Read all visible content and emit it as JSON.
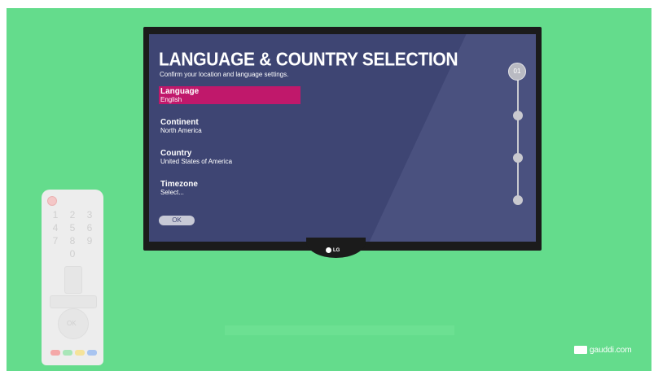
{
  "screen": {
    "title": "LANGUAGE & COUNTRY SELECTION",
    "subtitle": "Confirm your location and language settings.",
    "settings": [
      {
        "label": "Language",
        "value": "English",
        "active": true
      },
      {
        "label": "Continent",
        "value": "North America",
        "active": false
      },
      {
        "label": "Country",
        "value": "United States of America",
        "active": false
      },
      {
        "label": "Timezone",
        "value": "Select...",
        "active": false
      }
    ],
    "ok_label": "OK",
    "step_label": "01",
    "brand": "LG",
    "colors": {
      "background": "#64dc8c",
      "screen": "#3e4573",
      "highlight": "#c0186b"
    }
  },
  "remote": {
    "keys": [
      "1",
      "2",
      "3",
      "4",
      "5",
      "6",
      "7",
      "8",
      "9",
      "0"
    ],
    "ok_label": "OK",
    "color_keys": [
      "#f4a8a8",
      "#a8e6b8",
      "#f5e39a",
      "#a8c4f0"
    ]
  },
  "watermark": {
    "text": "gauddi.com"
  }
}
